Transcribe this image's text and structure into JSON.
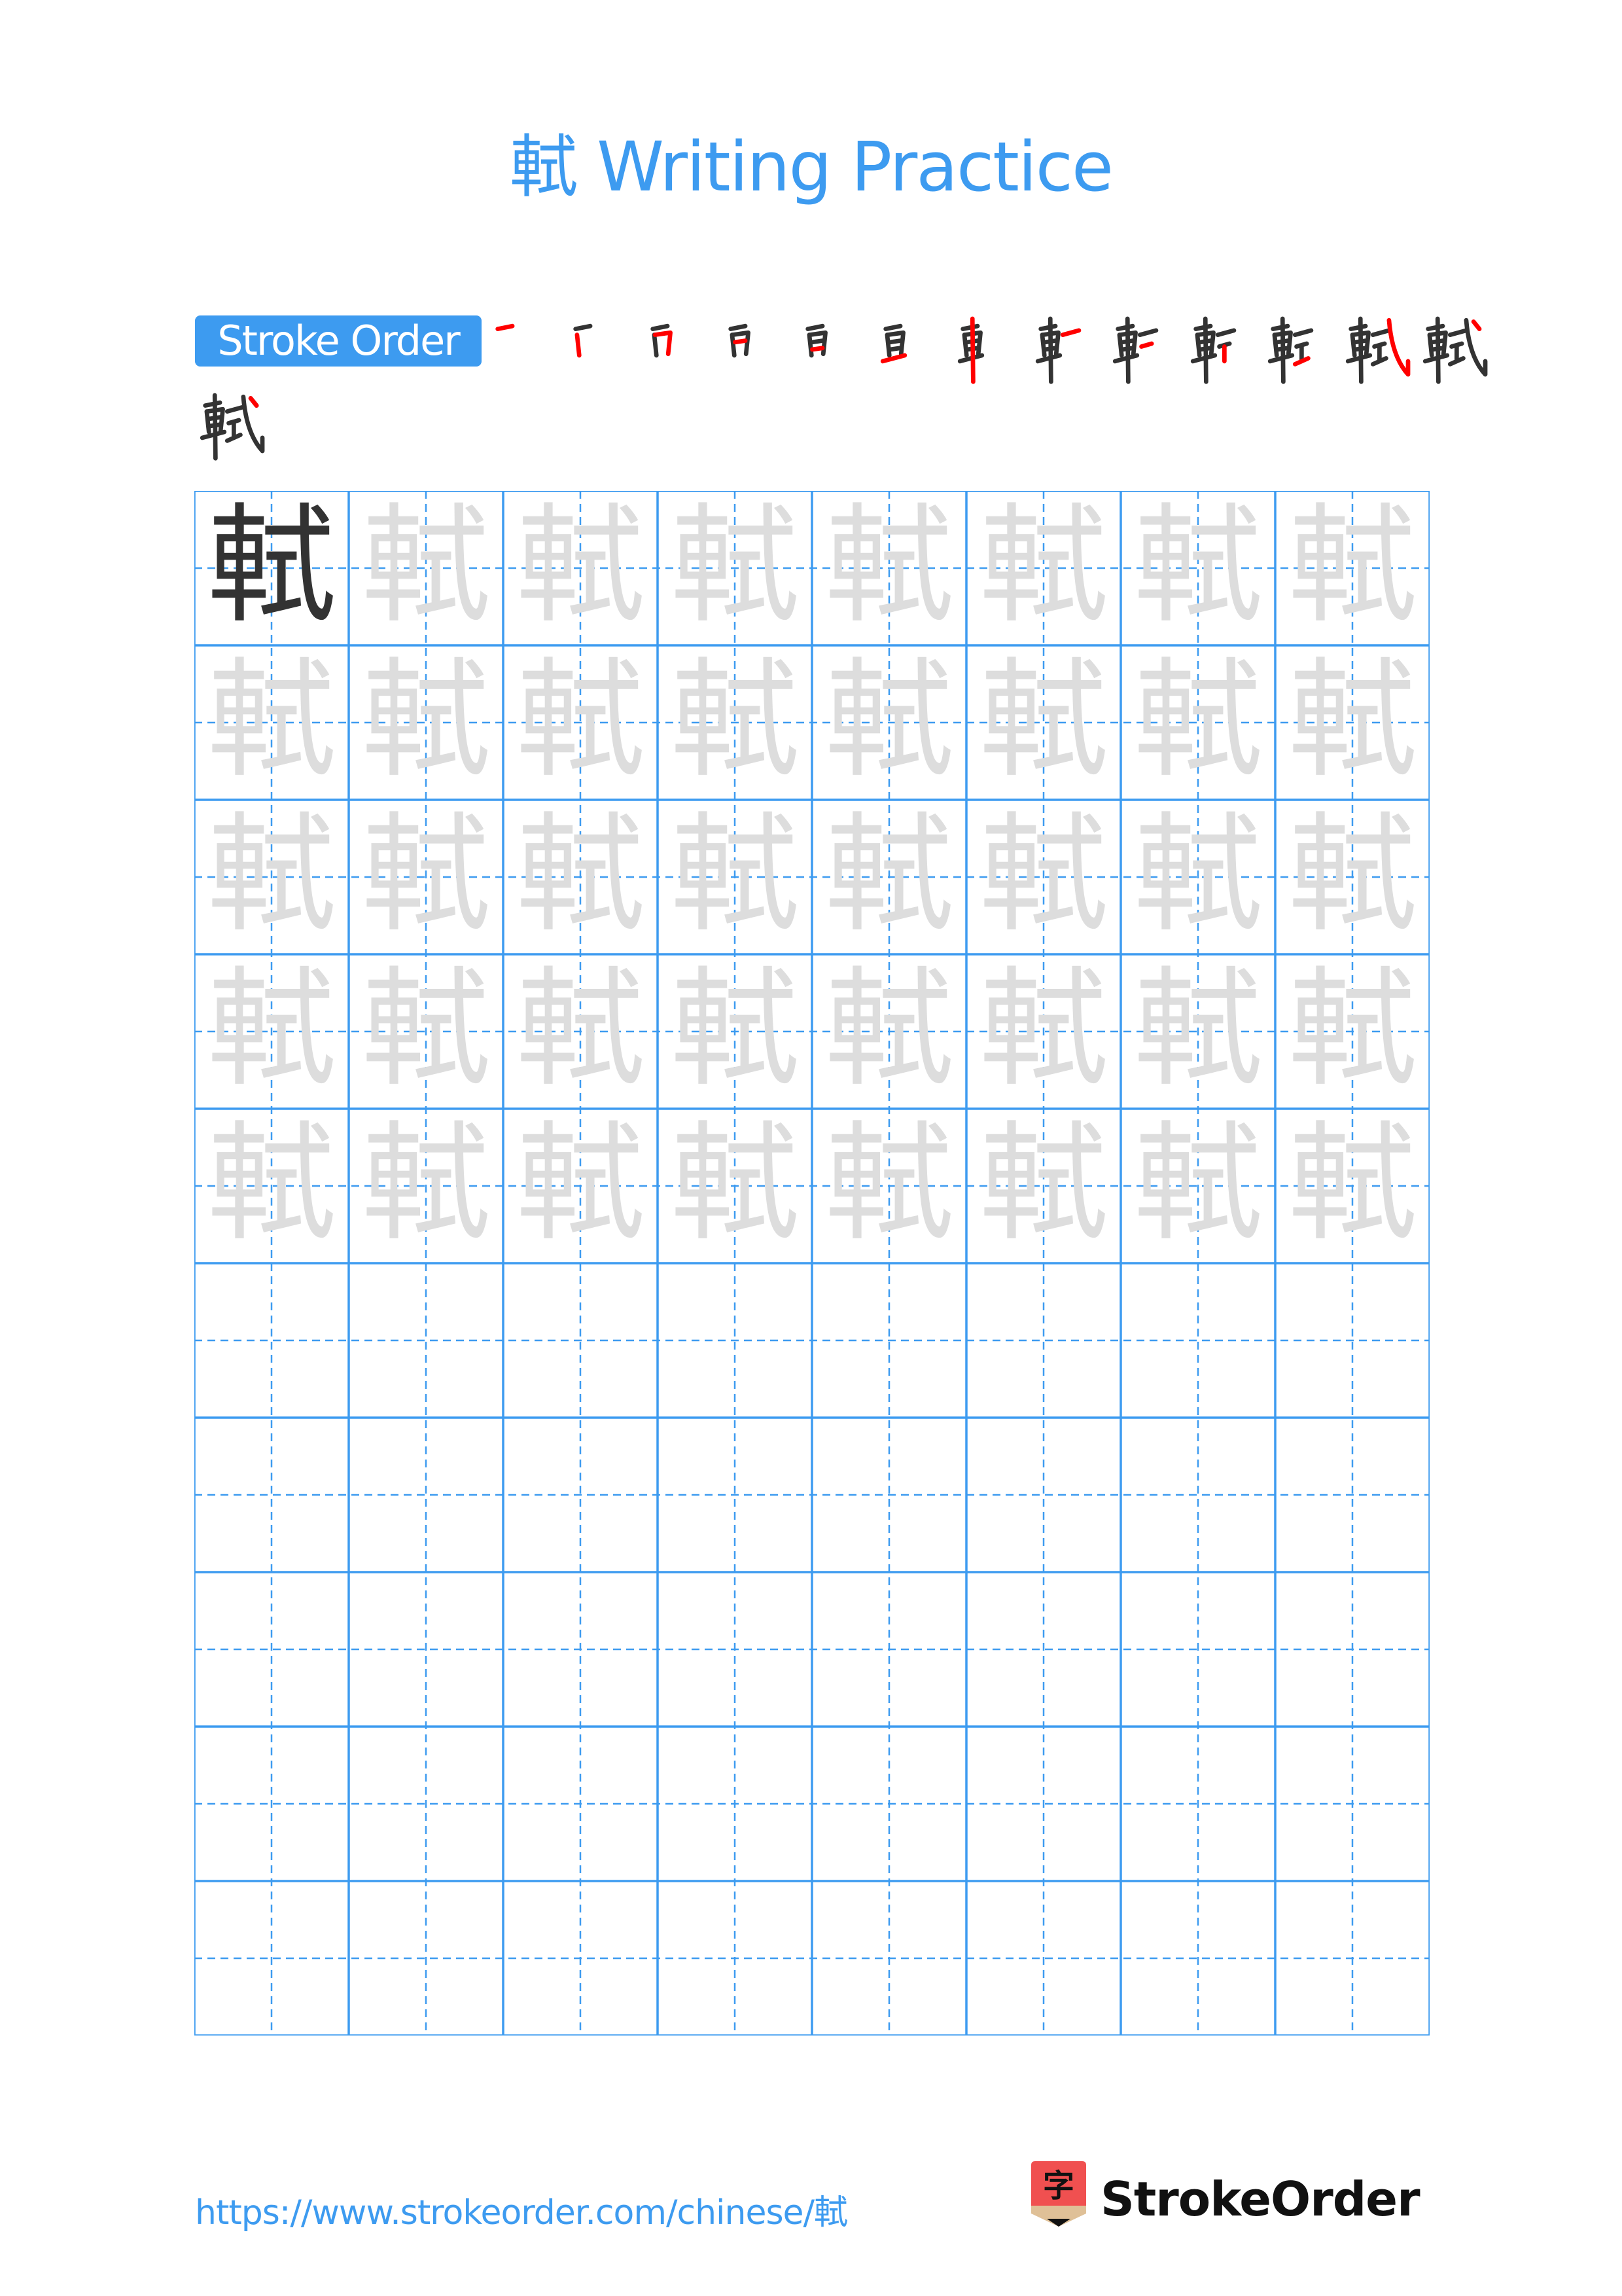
{
  "title": "軾 Writing Practice",
  "character": "軾",
  "stroke_order": {
    "label": "Stroke Order",
    "stroke_count": 14,
    "frames": [
      {
        "step": 1,
        "shown": "一"
      },
      {
        "step": 2,
        "shown": "丆"
      },
      {
        "step": 3,
        "shown": "帀"
      },
      {
        "step": 4,
        "shown": "百"
      },
      {
        "step": 5,
        "shown": "亘"
      },
      {
        "step": 6,
        "shown": "亘"
      },
      {
        "step": 7,
        "shown": "車"
      },
      {
        "step": 8,
        "shown": "車"
      },
      {
        "step": 9,
        "shown": "軒"
      },
      {
        "step": 10,
        "shown": "軒"
      },
      {
        "step": 11,
        "shown": "軒"
      },
      {
        "step": 12,
        "shown": "軾"
      },
      {
        "step": 13,
        "shown": "軾"
      },
      {
        "step": 14,
        "shown": "軾"
      }
    ],
    "highlight_color": "#ff0000",
    "ink_color": "#333333"
  },
  "grid": {
    "rows": 10,
    "cols": 8,
    "model_cells": 1,
    "trace_rows": 5,
    "line_color": "#3d9bf0",
    "model_color": "#333333",
    "trace_color": "#dddddd"
  },
  "footer": {
    "url": "https://www.strokeorder.com/chinese/軾",
    "logo_char": "字",
    "logo_text": "StrokeOrder"
  },
  "colors": {
    "accent": "#3d9bf0",
    "logo_red": "#f05050",
    "logo_tan": "#dfc097"
  }
}
